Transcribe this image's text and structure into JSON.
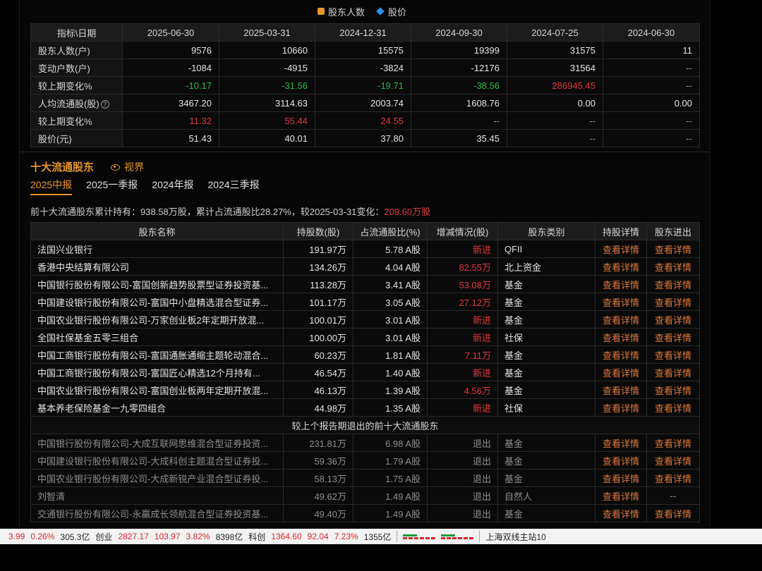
{
  "legend": [
    {
      "label": "股东人数",
      "color": "#e8962b",
      "shape": "square"
    },
    {
      "label": "股价",
      "color": "#2f8ff0",
      "shape": "diamond"
    }
  ],
  "holders_table": {
    "header": [
      "指标\\日期",
      "2025-06-30",
      "2025-03-31",
      "2024-12-31",
      "2024-09-30",
      "2024-07-25",
      "2024-06-30"
    ],
    "rows": [
      {
        "label": "股东人数(户)",
        "values": [
          "9576",
          "10660",
          "15575",
          "19399",
          "31575",
          "11"
        ],
        "tone": [
          "",
          "",
          "",
          "",
          "",
          ""
        ]
      },
      {
        "label": "变动户数(户)",
        "values": [
          "-1084",
          "-4915",
          "-3824",
          "-12176",
          "31564",
          "--"
        ],
        "tone": [
          "",
          "",
          "",
          "",
          "",
          "dim"
        ]
      },
      {
        "label": "较上期变化%",
        "values": [
          "-10.17",
          "-31.56",
          "-19.71",
          "-38.56",
          "286945.45",
          "--"
        ],
        "tone": [
          "green",
          "green",
          "green",
          "green",
          "red",
          "dim"
        ]
      },
      {
        "label": "人均流通股(股)",
        "values": [
          "3467.20",
          "3114.63",
          "2003.74",
          "1608.76",
          "0.00",
          "0.00"
        ],
        "tone": [
          "",
          "",
          "",
          "",
          "",
          ""
        ]
      },
      {
        "label": "较上期变化%",
        "values": [
          "11.32",
          "55.44",
          "24.55",
          "--",
          "--",
          "--"
        ],
        "tone": [
          "red",
          "red",
          "red",
          "dim",
          "dim",
          "dim"
        ]
      },
      {
        "label": "股价(元)",
        "values": [
          "51.43",
          "40.01",
          "37.80",
          "35.45",
          "--",
          "--"
        ],
        "tone": [
          "",
          "",
          "",
          "",
          "dim",
          "dim"
        ]
      }
    ],
    "help_icon": "?"
  },
  "section": {
    "title": "十大流通股东",
    "view_label": "视界",
    "tabs": [
      "2025中报",
      "2025一季报",
      "2024年报",
      "2024三季报"
    ],
    "active_tab": 0
  },
  "summary": {
    "text": "前十大流通股东累计持有：938.58万股，累计占流通股比28.27%，较2025-03-31变化：",
    "change": "209.60万股"
  },
  "top10": {
    "header": [
      "股东名称",
      "持股数(股)",
      "占流通股比(%)",
      "增减情况(股)",
      "股东类别",
      "持股详情",
      "股东进出"
    ],
    "rows": [
      {
        "name": "法国兴业银行",
        "shares": "191.97万",
        "ratio": "5.78 A股",
        "change": "新进",
        "type": "QFII"
      },
      {
        "name": "香港中央结算有限公司",
        "shares": "134.26万",
        "ratio": "4.04 A股",
        "change": "82.55万",
        "type": "北上资金"
      },
      {
        "name": "中国银行股份有限公司-富国创新趋势股票型证券投资基...",
        "shares": "113.28万",
        "ratio": "3.41 A股",
        "change": "53.08万",
        "type": "基金"
      },
      {
        "name": "中国建设银行股份有限公司-富国中小盘精选混合型证券...",
        "shares": "101.17万",
        "ratio": "3.05 A股",
        "change": "27.12万",
        "type": "基金"
      },
      {
        "name": "中国农业银行股份有限公司-万家创业板2年定期开放混...",
        "shares": "100.01万",
        "ratio": "3.01 A股",
        "change": "新进",
        "type": "基金"
      },
      {
        "name": "全国社保基金五零三组合",
        "shares": "100.00万",
        "ratio": "3.01 A股",
        "change": "新进",
        "type": "社保"
      },
      {
        "name": "中国工商银行股份有限公司-富国通胀通缩主题轮动混合...",
        "shares": "60.23万",
        "ratio": "1.81 A股",
        "change": "7.11万",
        "type": "基金"
      },
      {
        "name": "中国工商银行股份有限公司-富国匠心精选12个月持有...",
        "shares": "46.54万",
        "ratio": "1.40 A股",
        "change": "新进",
        "type": "基金"
      },
      {
        "name": "中国农业银行股份有限公司-富国创业板两年定期开放混...",
        "shares": "46.13万",
        "ratio": "1.39 A股",
        "change": "4.56万",
        "type": "基金"
      },
      {
        "name": "基本养老保险基金一九零四组合",
        "shares": "44.98万",
        "ratio": "1.35 A股",
        "change": "新进",
        "type": "社保"
      }
    ],
    "exited_title": "较上个报告期退出的前十大流通股东",
    "exited_rows": [
      {
        "name": "中国银行股份有限公司-大成互联网思维混合型证券投资...",
        "shares": "231.81万",
        "ratio": "6.98 A股",
        "change": "退出",
        "type": "基金",
        "flow": "查看详情"
      },
      {
        "name": "中国建设银行股份有限公司-大成科创主题混合型证券投...",
        "shares": "59.36万",
        "ratio": "1.79 A股",
        "change": "退出",
        "type": "基金",
        "flow": "查看详情"
      },
      {
        "name": "中国农业银行股份有限公司-大成新锐产业混合型证券投...",
        "shares": "58.13万",
        "ratio": "1.75 A股",
        "change": "退出",
        "type": "基金",
        "flow": "查看详情"
      },
      {
        "name": "刘智清",
        "shares": "49.62万",
        "ratio": "1.49 A股",
        "change": "退出",
        "type": "自然人",
        "flow": "--"
      },
      {
        "name": "交通银行股份有限公司-永赢成长领航混合型证券投资基...",
        "shares": "49.40万",
        "ratio": "1.49 A股",
        "change": "退出",
        "type": "基金",
        "flow": "查看详情"
      }
    ],
    "link_label": "查看详情"
  },
  "statusbar": {
    "items": [
      {
        "text": "3.99",
        "tone": "red"
      },
      {
        "text": "0.26%",
        "tone": "red"
      },
      {
        "text": "305.3亿",
        "tone": ""
      },
      {
        "text": "创业",
        "tone": ""
      },
      {
        "text": "2827.17",
        "tone": "red"
      },
      {
        "text": "103.97",
        "tone": "red"
      },
      {
        "text": "3.82%",
        "tone": "red"
      },
      {
        "text": "8398亿",
        "tone": ""
      },
      {
        "text": "科创",
        "tone": ""
      },
      {
        "text": "1364.60",
        "tone": "red"
      },
      {
        "text": "92.04",
        "tone": "red"
      },
      {
        "text": "7.23%",
        "tone": "red"
      },
      {
        "text": "1355亿",
        "tone": ""
      }
    ],
    "server": "上海双线主站10"
  }
}
